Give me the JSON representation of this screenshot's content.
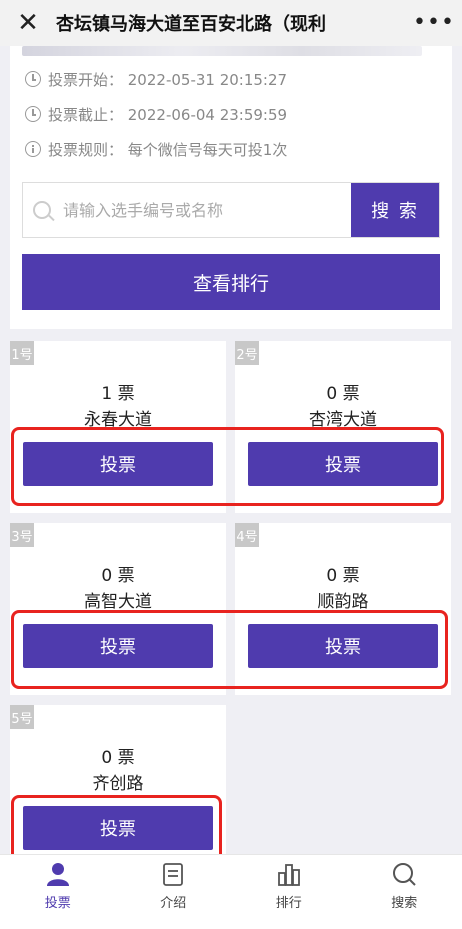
{
  "topbar": {
    "title": "杏坛镇马海大道至百安北路（现利",
    "close_icon": "close-icon",
    "more_icon": "more-icon"
  },
  "info": {
    "start": "投票开始：  2022-05-31 20:15:27",
    "end": "投票截止：  2022-06-04 23:59:59",
    "rule": "投票规则：  每个微信号每天可投1次"
  },
  "search": {
    "placeholder": "请输入选手编号或名称",
    "button": "搜 索"
  },
  "rank_button": "查看排行",
  "contestants": [
    {
      "badge": "1号",
      "votes": "1 票",
      "name": "永春大道",
      "button": "投票"
    },
    {
      "badge": "2号",
      "votes": "0 票",
      "name": "杏湾大道",
      "button": "投票"
    },
    {
      "badge": "3号",
      "votes": "0 票",
      "name": "高智大道",
      "button": "投票"
    },
    {
      "badge": "4号",
      "votes": "0 票",
      "name": "顺韵路",
      "button": "投票"
    },
    {
      "badge": "5号",
      "votes": "0 票",
      "name": "齐创路",
      "button": "投票"
    }
  ],
  "tabs": [
    {
      "label": "投票",
      "icon": "user-icon"
    },
    {
      "label": "介绍",
      "icon": "document-icon"
    },
    {
      "label": "排行",
      "icon": "bar-chart-icon"
    },
    {
      "label": "搜索",
      "icon": "search-icon"
    }
  ],
  "colors": {
    "accent": "#4f3bae",
    "highlight": "#e8231f"
  }
}
